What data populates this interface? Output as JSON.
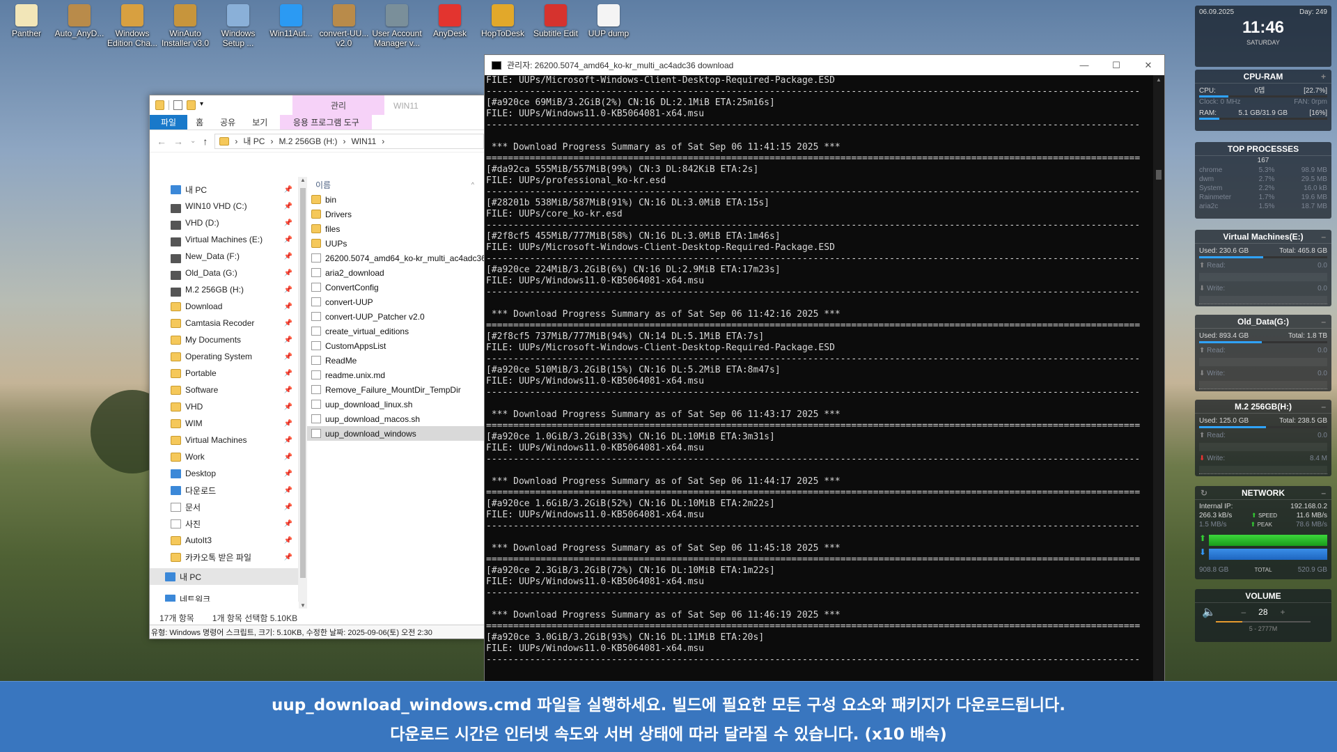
{
  "desktop": {
    "icons": [
      {
        "label": "Panther",
        "icon": "document-icon",
        "color": "#f2e6b8"
      },
      {
        "label": "Auto_AnyD...",
        "icon": "package-icon",
        "color": "#b98b4a"
      },
      {
        "label": "Windows\nEdition Cha...",
        "icon": "wrench-icon",
        "color": "#d8a040"
      },
      {
        "label": "WinAuto\nInstaller v3.0",
        "icon": "box-icon",
        "color": "#c7953c"
      },
      {
        "label": "Windows\nSetup ...",
        "icon": "setup-icon",
        "color": "#8ab0d8"
      },
      {
        "label": "Win11Aut...",
        "icon": "windows-icon",
        "color": "#2b9af3"
      },
      {
        "label": "convert-UU...\nv2.0",
        "icon": "package-icon",
        "color": "#b98b4a"
      },
      {
        "label": "User Account\nManager v...",
        "icon": "users-icon",
        "color": "#7a8f9a"
      },
      {
        "label": "AnyDesk",
        "icon": "anydesk-icon",
        "color": "#e3342f"
      },
      {
        "label": "HopToDesk",
        "icon": "kangaroo-icon",
        "color": "#e2a82a"
      },
      {
        "label": "Subtitle Edit",
        "icon": "subtitle-icon",
        "color": "#d6332e"
      },
      {
        "label": "UUP dump",
        "icon": "uup-icon",
        "color": "#f4f4f4"
      }
    ]
  },
  "explorer": {
    "context_tab": "관리",
    "window_title": "WIN11",
    "ribbon_tabs": [
      "파일",
      "홈",
      "공유",
      "보기",
      "응용 프로그램 도구"
    ],
    "breadcrumb": [
      "내 PC",
      "M.2 256GB (H:)",
      "WIN11"
    ],
    "nav_items": [
      {
        "label": "내 PC",
        "icon": "pc-icon",
        "pin": true
      },
      {
        "label": "WIN10 VHD (C:)",
        "icon": "drive-icon",
        "pin": true
      },
      {
        "label": "VHD (D:)",
        "icon": "drive-icon",
        "pin": true
      },
      {
        "label": "Virtual Machines (E:)",
        "icon": "drive-icon",
        "pin": true
      },
      {
        "label": "New_Data (F:)",
        "icon": "drive-icon",
        "pin": true
      },
      {
        "label": "Old_Data (G:)",
        "icon": "drive-icon",
        "pin": true
      },
      {
        "label": "M.2 256GB (H:)",
        "icon": "drive-icon",
        "pin": true
      },
      {
        "label": "Download",
        "icon": "folder-icon",
        "pin": true
      },
      {
        "label": "Camtasia Recoder",
        "icon": "folder-icon",
        "pin": true
      },
      {
        "label": "My Documents",
        "icon": "folder-icon",
        "pin": true
      },
      {
        "label": "Operating System",
        "icon": "folder-icon",
        "pin": true
      },
      {
        "label": "Portable",
        "icon": "folder-icon",
        "pin": true
      },
      {
        "label": "Software",
        "icon": "folder-icon",
        "pin": true
      },
      {
        "label": "VHD",
        "icon": "folder-icon",
        "pin": true
      },
      {
        "label": "WIM",
        "icon": "folder-icon",
        "pin": true
      },
      {
        "label": "Virtual Machines",
        "icon": "folder-icon",
        "pin": true
      },
      {
        "label": "Work",
        "icon": "folder-icon",
        "pin": true
      },
      {
        "label": "Desktop",
        "icon": "desktop-icon",
        "pin": true
      },
      {
        "label": "다운로드",
        "icon": "download-icon",
        "pin": true
      },
      {
        "label": "문서",
        "icon": "document-icon",
        "pin": true
      },
      {
        "label": "사진",
        "icon": "picture-icon",
        "pin": true
      },
      {
        "label": "AutoIt3",
        "icon": "folder-icon",
        "pin": true
      },
      {
        "label": "카카오톡 받은 파일",
        "icon": "folder-icon",
        "pin": true
      }
    ],
    "nav_pc": "내 PC",
    "nav_network": "네트워크",
    "column_name": "이름",
    "files": [
      {
        "name": "bin",
        "icon": "folder-icon"
      },
      {
        "name": "Drivers",
        "icon": "folder-icon"
      },
      {
        "name": "files",
        "icon": "folder-icon"
      },
      {
        "name": "UUPs",
        "icon": "folder-icon"
      },
      {
        "name": "26200.5074_amd64_ko-kr_multi_ac4adc36",
        "icon": "image-file-icon"
      },
      {
        "name": "aria2_download",
        "icon": "text-file-icon"
      },
      {
        "name": "ConvertConfig",
        "icon": "config-file-icon"
      },
      {
        "name": "convert-UUP",
        "icon": "script-file-icon"
      },
      {
        "name": "convert-UUP_Patcher v2.0",
        "icon": "patcher-icon"
      },
      {
        "name": "create_virtual_editions",
        "icon": "script-file-icon"
      },
      {
        "name": "CustomAppsList",
        "icon": "text-file-icon"
      },
      {
        "name": "ReadMe",
        "icon": "chrome-icon"
      },
      {
        "name": "readme.unix.md",
        "icon": "text-file-icon"
      },
      {
        "name": "Remove_Failure_MountDir_TempDir",
        "icon": "script-file-icon"
      },
      {
        "name": "uup_download_linux.sh",
        "icon": "text-file-icon"
      },
      {
        "name": "uup_download_macos.sh",
        "icon": "text-file-icon"
      },
      {
        "name": "uup_download_windows",
        "icon": "script-file-icon",
        "selected": true
      }
    ],
    "status_count": "17개 항목",
    "status_selected": "1개 항목 선택함 5.10KB",
    "info": "유형: Windows 명령어 스크립트, 크기: 5.10KB, 수정한 날짜: 2025-09-06(토) 오전 2:30"
  },
  "console": {
    "title": "관리자:  26200.5074_amd64_ko-kr_multi_ac4adc36 download",
    "lines": [
      "FILE: UUPs/Microsoft-Windows-Client-Desktop-Required-Package.ESD",
      "------------------------------------------------------------------------------------------------------------------------",
      "[#a920ce 69MiB/3.2GiB(2%) CN:16 DL:2.1MiB ETA:25m16s]",
      "FILE: UUPs/Windows11.0-KB5064081-x64.msu",
      "------------------------------------------------------------------------------------------------------------------------",
      "",
      " *** Download Progress Summary as of Sat Sep 06 11:41:15 2025 ***",
      "========================================================================================================================",
      "[#da92ca 555MiB/557MiB(99%) CN:3 DL:842KiB ETA:2s]",
      "FILE: UUPs/professional_ko-kr.esd",
      "------------------------------------------------------------------------------------------------------------------------",
      "[#28201b 538MiB/587MiB(91%) CN:16 DL:3.0MiB ETA:15s]",
      "FILE: UUPs/core_ko-kr.esd",
      "------------------------------------------------------------------------------------------------------------------------",
      "[#2f8cf5 455MiB/777MiB(58%) CN:16 DL:3.0MiB ETA:1m46s]",
      "FILE: UUPs/Microsoft-Windows-Client-Desktop-Required-Package.ESD",
      "------------------------------------------------------------------------------------------------------------------------",
      "[#a920ce 224MiB/3.2GiB(6%) CN:16 DL:2.9MiB ETA:17m23s]",
      "FILE: UUPs/Windows11.0-KB5064081-x64.msu",
      "------------------------------------------------------------------------------------------------------------------------",
      "",
      " *** Download Progress Summary as of Sat Sep 06 11:42:16 2025 ***",
      "========================================================================================================================",
      "[#2f8cf5 737MiB/777MiB(94%) CN:14 DL:5.1MiB ETA:7s]",
      "FILE: UUPs/Microsoft-Windows-Client-Desktop-Required-Package.ESD",
      "------------------------------------------------------------------------------------------------------------------------",
      "[#a920ce 510MiB/3.2GiB(15%) CN:16 DL:5.2MiB ETA:8m47s]",
      "FILE: UUPs/Windows11.0-KB5064081-x64.msu",
      "------------------------------------------------------------------------------------------------------------------------",
      "",
      " *** Download Progress Summary as of Sat Sep 06 11:43:17 2025 ***",
      "========================================================================================================================",
      "[#a920ce 1.0GiB/3.2GiB(33%) CN:16 DL:10MiB ETA:3m31s]",
      "FILE: UUPs/Windows11.0-KB5064081-x64.msu",
      "------------------------------------------------------------------------------------------------------------------------",
      "",
      " *** Download Progress Summary as of Sat Sep 06 11:44:17 2025 ***",
      "========================================================================================================================",
      "[#a920ce 1.6GiB/3.2GiB(52%) CN:16 DL:10MiB ETA:2m22s]",
      "FILE: UUPs/Windows11.0-KB5064081-x64.msu",
      "------------------------------------------------------------------------------------------------------------------------",
      "",
      " *** Download Progress Summary as of Sat Sep 06 11:45:18 2025 ***",
      "========================================================================================================================",
      "[#a920ce 2.3GiB/3.2GiB(72%) CN:16 DL:10MiB ETA:1m22s]",
      "FILE: UUPs/Windows11.0-KB5064081-x64.msu",
      "------------------------------------------------------------------------------------------------------------------------",
      "",
      " *** Download Progress Summary as of Sat Sep 06 11:46:19 2025 ***",
      "========================================================================================================================",
      "[#a920ce 3.0GiB/3.2GiB(93%) CN:16 DL:11MiB ETA:20s]",
      "FILE: UUPs/Windows11.0-KB5064081-x64.msu",
      "------------------------------------------------------------------------------------------------------------------------"
    ]
  },
  "widgets": {
    "clock": {
      "date": "06.09.2025",
      "day_of_year": "Day: 249",
      "time": "11:46",
      "weekday": "SATURDAY"
    },
    "cpu_ram": {
      "title": "CPU-RAM",
      "cpu_label": "CPU:",
      "cpu_name": "0뎁",
      "cpu_pct": "[22.7%]",
      "clock": "Clock: 0 MHz",
      "fan": "FAN: 0rpm",
      "ram_label": "RAM:",
      "ram_value": "5.1 GB/31.9 GB",
      "ram_pct": "[16%]"
    },
    "top": {
      "title": "TOP PROCESSES",
      "count": "167",
      "rows": [
        {
          "name": "chrome",
          "pct": "5.3%",
          "mem": "98.9 MB"
        },
        {
          "name": "dwm",
          "pct": "2.7%",
          "mem": "29.5 MB"
        },
        {
          "name": "System",
          "pct": "2.2%",
          "mem": "16.0 kB"
        },
        {
          "name": "Rainmeter",
          "pct": "1.7%",
          "mem": "19.6 MB"
        },
        {
          "name": "aria2c",
          "pct": "1.5%",
          "mem": "18.7 MB"
        }
      ]
    },
    "disks": [
      {
        "title": "Virtual Machines(E:)",
        "used": "Used: 230.6 GB",
        "total": "Total: 465.8 GB",
        "read": "Read:",
        "read_v": "0.0",
        "write": "Write:",
        "write_v": "0.0"
      },
      {
        "title": "Old_Data(G:)",
        "used": "Used: 893.4 GB",
        "total": "Total: 1.8 TB",
        "read": "Read:",
        "read_v": "0.0",
        "write": "Write:",
        "write_v": "0.0"
      },
      {
        "title": "M.2 256GB(H:)",
        "used": "Used: 125.0 GB",
        "total": "Total: 238.5 GB",
        "read": "Read:",
        "read_v": "0.0",
        "write": "Write:",
        "write_v": "8.4 M"
      }
    ],
    "network": {
      "title": "NETWORK",
      "ip_label": "Internal IP:",
      "ip": "192.168.0.2",
      "down": "266.3 kB/s",
      "speed_label": "SPEED",
      "speed": "11.6 MB/s",
      "up": "1.5 MB/s",
      "peak_label": "PEAK",
      "peak": "78.6 MB/s",
      "total_down": "908.8 GB",
      "total_label": "TOTAL",
      "total_up": "520.9 GB"
    },
    "volume": {
      "title": "VOLUME",
      "value": "28",
      "device": "5 - 2777M"
    }
  },
  "caption": {
    "line1": "uup_download_windows.cmd 파일을 실행하세요. 빌드에 필요한 모든 구성 요소와 패키지가 다운로드됩니다.",
    "line2": "다운로드 시간은 인터넷 속도와 서버 상태에 따라 달라질 수 있습니다. (x10 배속)"
  },
  "colors": {
    "caption_bg": "#3976bf",
    "file_tab": "#1979ca",
    "context_tab": "#f6d2f8",
    "console_bg": "#0c0c0c"
  }
}
